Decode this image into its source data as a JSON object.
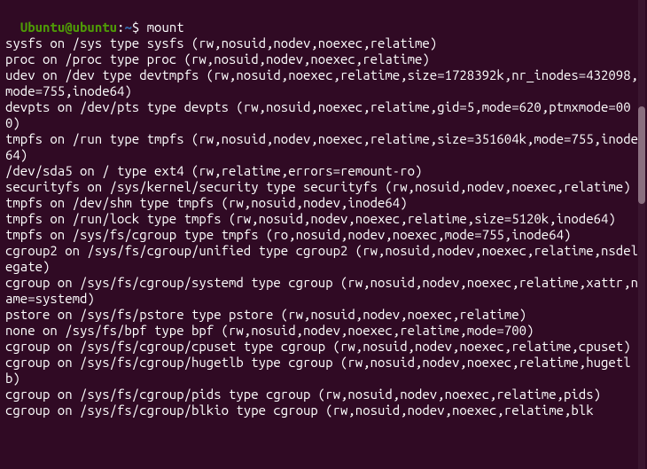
{
  "prompt": {
    "user": "Ubuntu",
    "at": "@",
    "host": "ubuntu",
    "colon": ":",
    "path": "~",
    "dollar": "$ "
  },
  "command": "mount",
  "output_lines": [
    "sysfs on /sys type sysfs (rw,nosuid,nodev,noexec,relatime)",
    "proc on /proc type proc (rw,nosuid,nodev,noexec,relatime)",
    "udev on /dev type devtmpfs (rw,nosuid,noexec,relatime,size=1728392k,nr_inodes=432098,mode=755,inode64)",
    "devpts on /dev/pts type devpts (rw,nosuid,noexec,relatime,gid=5,mode=620,ptmxmode=000)",
    "tmpfs on /run type tmpfs (rw,nosuid,nodev,noexec,relatime,size=351604k,mode=755,inode64)",
    "/dev/sda5 on / type ext4 (rw,relatime,errors=remount-ro)",
    "securityfs on /sys/kernel/security type securityfs (rw,nosuid,nodev,noexec,relatime)",
    "tmpfs on /dev/shm type tmpfs (rw,nosuid,nodev,inode64)",
    "tmpfs on /run/lock type tmpfs (rw,nosuid,nodev,noexec,relatime,size=5120k,inode64)",
    "tmpfs on /sys/fs/cgroup type tmpfs (ro,nosuid,nodev,noexec,mode=755,inode64)",
    "cgroup2 on /sys/fs/cgroup/unified type cgroup2 (rw,nosuid,nodev,noexec,relatime,nsdelegate)",
    "cgroup on /sys/fs/cgroup/systemd type cgroup (rw,nosuid,nodev,noexec,relatime,xattr,name=systemd)",
    "pstore on /sys/fs/pstore type pstore (rw,nosuid,nodev,noexec,relatime)",
    "none on /sys/fs/bpf type bpf (rw,nosuid,nodev,noexec,relatime,mode=700)",
    "cgroup on /sys/fs/cgroup/cpuset type cgroup (rw,nosuid,nodev,noexec,relatime,cpuset)",
    "cgroup on /sys/fs/cgroup/hugetlb type cgroup (rw,nosuid,nodev,noexec,relatime,hugetlb)",
    "cgroup on /sys/fs/cgroup/pids type cgroup (rw,nosuid,nodev,noexec,relatime,pids)",
    "cgroup on /sys/fs/cgroup/blkio type cgroup (rw,nosuid,nodev,noexec,relatime,blk"
  ]
}
